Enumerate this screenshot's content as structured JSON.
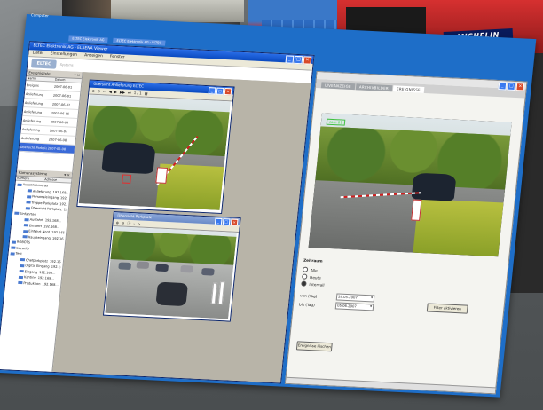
{
  "background": {
    "sponsor_logo": "MICHELIN"
  },
  "desktop": {
    "label": "Computer"
  },
  "taskbar": {
    "tabs": [
      "ELTEC Elektronik AG",
      "ELTEC Elektronik AG - ELTEC"
    ]
  },
  "app": {
    "title": "ELTEC Elektronik AG - ELSENA Viewer",
    "menu": [
      "Datei",
      "Einstellungen",
      "Anzeigen",
      "Fenster"
    ],
    "logo": "ELTEC",
    "logo_sub": "Systems"
  },
  "events": {
    "header": "Ereignisliste",
    "columns": [
      "Name",
      "Datum"
    ],
    "rows": [
      {
        "name": "Ereignis",
        "date": "2007-06-01"
      },
      {
        "name": "Anlieferung",
        "date": "2007-06-01"
      },
      {
        "name": "Anlieferung",
        "date": "2007-06-02"
      },
      {
        "name": "Anlieferung",
        "date": "2007-06-05"
      },
      {
        "name": "Anlieferung",
        "date": "2007-06-06"
      },
      {
        "name": "Anlieferung",
        "date": "2007-06-07"
      },
      {
        "name": "Anlieferung",
        "date": "2007-06-08"
      },
      {
        "name": "Übersicht Parkplatz",
        "date": "2007-06-08"
      }
    ]
  },
  "cameras": {
    "header": "Kamerasysteme",
    "columns": [
      "Kamera",
      "Adresse"
    ],
    "tree": [
      {
        "level": 0,
        "label": "Aussenkameras",
        "addr": ""
      },
      {
        "level": 1,
        "label": "Anlieferung",
        "addr": "192.168..."
      },
      {
        "level": 1,
        "label": "Personaleingang",
        "addr": "192.168..."
      },
      {
        "level": 1,
        "label": "Treppe Parkplatz",
        "addr": "192.168..."
      },
      {
        "level": 1,
        "label": "Übersicht Parkplatz",
        "addr": "192.168..."
      },
      {
        "level": 0,
        "label": "Einfahrten",
        "addr": ""
      },
      {
        "level": 1,
        "label": "Ausfahrt",
        "addr": "192.168..."
      },
      {
        "level": 1,
        "label": "Einfahrt",
        "addr": "192.168..."
      },
      {
        "level": 1,
        "label": "Einfahrt Nord",
        "addr": "192.168..."
      },
      {
        "level": 1,
        "label": "Haupteingang",
        "addr": "192.168..."
      },
      {
        "level": 0,
        "label": "ROBOTS",
        "addr": ""
      },
      {
        "level": 0,
        "label": "Security",
        "addr": ""
      },
      {
        "level": 0,
        "label": "Test",
        "addr": ""
      },
      {
        "level": 1,
        "label": "Chefparkplatz",
        "addr": "192.168..."
      },
      {
        "level": 1,
        "label": "Digital Eingang",
        "addr": "192.168..."
      },
      {
        "level": 1,
        "label": "Eingang",
        "addr": "192.168..."
      },
      {
        "level": 1,
        "label": "Kantine",
        "addr": "192.168..."
      },
      {
        "level": 1,
        "label": "Produktion",
        "addr": "192.168..."
      }
    ]
  },
  "viewer1": {
    "title": "Übersicht Anlieferung ELTEC",
    "toolbar_value": "1 / 1"
  },
  "viewer2": {
    "title": "Übersicht Parkplatz"
  },
  "right": {
    "tabs": [
      "LIVEANZEIGE",
      "ARCHIVBILDER",
      "EREIGNISSE"
    ],
    "active_tab": 2,
    "overlay_box": "cam 01",
    "range_label": "Zeitraum",
    "options": [
      {
        "label": "Alle",
        "checked": false
      },
      {
        "label": "Heute",
        "checked": false
      },
      {
        "label": "Intervall",
        "checked": true
      }
    ],
    "from_label": "von (Tag)",
    "to_label": "bis (Tag)",
    "from_date": "28.05.2007",
    "to_date": "05.06.2007",
    "filter_button": "Filter aktivieren",
    "reset_button": "Ereignisse löschen"
  }
}
